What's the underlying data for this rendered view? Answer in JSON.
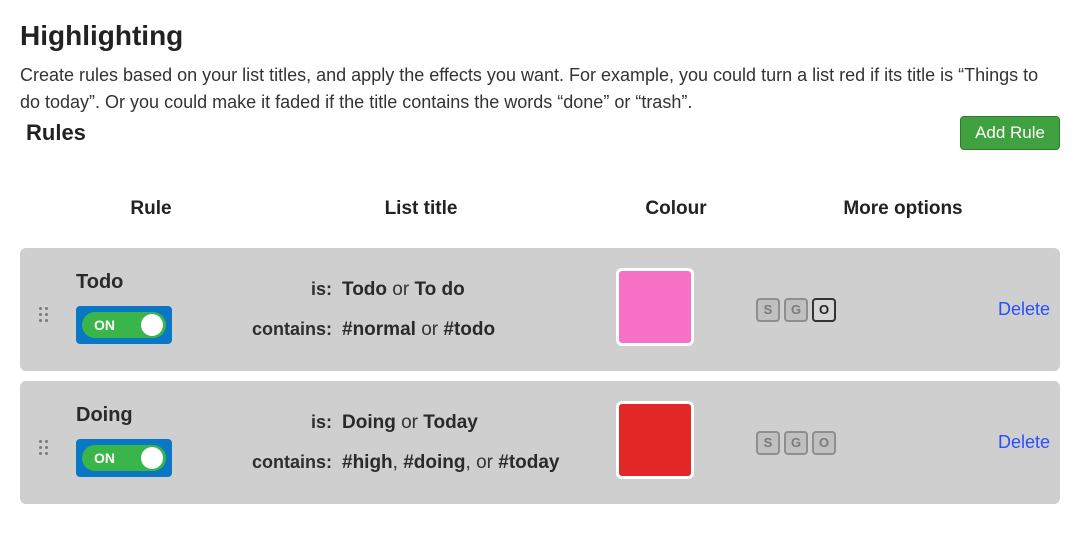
{
  "header": {
    "title": "Highlighting",
    "description": "Create rules based on your list titles, and apply the effects you want. For example, you could turn a list red if its title is “Things to do today”. Or you could make it faded if the title contains the words “done” or “trash”."
  },
  "rules_section": {
    "title": "Rules",
    "add_button_label": "Add Rule"
  },
  "columns": {
    "rule": "Rule",
    "list_title": "List title",
    "colour": "Colour",
    "more_options": "More options"
  },
  "labels": {
    "is": "is:",
    "contains": "contains:",
    "toggle_on": "ON",
    "delete": "Delete"
  },
  "option_chips": {
    "s": "S",
    "g": "G",
    "o": "O"
  },
  "rules": [
    {
      "name": "Todo",
      "enabled": true,
      "is_html": "<b>Todo</b> or <b>To do</b>",
      "contains_html": "<b>#normal</b> or <b>#todo</b>",
      "colour": "#f771c6",
      "option_active": "o"
    },
    {
      "name": "Doing",
      "enabled": true,
      "is_html": "<b>Doing</b> or <b>Today</b>",
      "contains_html": "<b>#high</b>, <b>#doing</b>, or <b>#today</b>",
      "colour": "#e32626",
      "option_active": null
    }
  ]
}
